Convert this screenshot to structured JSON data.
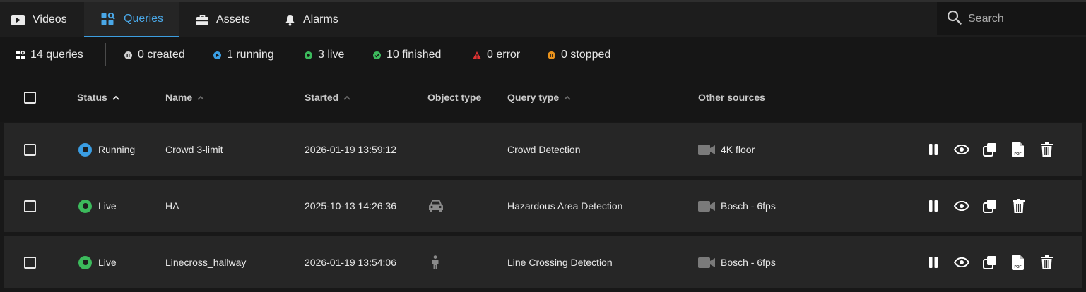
{
  "nav": {
    "tabs": [
      {
        "label": "Videos",
        "icon": "video-icon",
        "active": false
      },
      {
        "label": "Queries",
        "icon": "queries-icon",
        "active": true
      },
      {
        "label": "Assets",
        "icon": "briefcase-icon",
        "active": false
      },
      {
        "label": "Alarms",
        "icon": "bell-icon",
        "active": false
      }
    ],
    "search_placeholder": "Search"
  },
  "summary": {
    "total": "14 queries",
    "created": "0 created",
    "running": "1 running",
    "live": "3 live",
    "finished": "10 finished",
    "error": "0 error",
    "stopped": "0 stopped"
  },
  "colors": {
    "accent": "#3d9ee0",
    "running": "#3a9ee4",
    "live": "#3cba5c",
    "finished": "#3cba5c",
    "error": "#e03333",
    "stopped": "#e8921c",
    "created": "#cfcfcf"
  },
  "table": {
    "headers": {
      "status": "Status",
      "name": "Name",
      "started": "Started",
      "object_type": "Object type",
      "query_type": "Query type",
      "other_sources": "Other sources"
    },
    "rows": [
      {
        "status": "Running",
        "status_color": "#3a9ee4",
        "name": "Crowd 3-limit",
        "started": "2026-01-19 13:59:12",
        "object_icon": "",
        "query_type": "Crowd Detection",
        "source": "4K floor",
        "has_pdf": true
      },
      {
        "status": "Live",
        "status_color": "#3cba5c",
        "name": "HA",
        "started": "2025-10-13 14:26:36",
        "object_icon": "car-icon",
        "query_type": "Hazardous Area Detection",
        "source": "Bosch - 6fps",
        "has_pdf": false
      },
      {
        "status": "Live",
        "status_color": "#3cba5c",
        "name": "Linecross_hallway",
        "started": "2026-01-19 13:54:06",
        "object_icon": "person-icon",
        "query_type": "Line Crossing Detection",
        "source": "Bosch - 6fps",
        "has_pdf": true
      }
    ]
  }
}
